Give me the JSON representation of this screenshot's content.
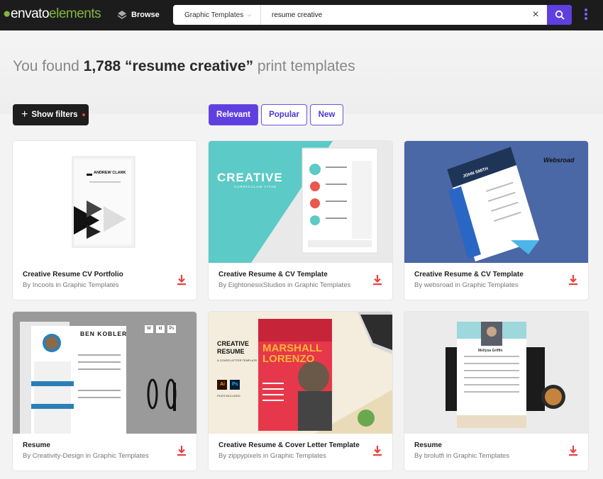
{
  "header": {
    "logo_text_a": "envato",
    "logo_text_b": "elements",
    "browse_label": "Browse",
    "category_select": "Graphic Templates",
    "search_value": "resume creative",
    "icons": [
      "browse-icon",
      "clear-icon",
      "search-icon",
      "more-icon"
    ],
    "accent": "#5f3fe0"
  },
  "results": {
    "prefix": "You found",
    "count_phrase": "1,788 “resume creative”",
    "suffix": "print templates"
  },
  "toolbar": {
    "show_filters": "Show filters",
    "sort": [
      {
        "label": "Relevant",
        "active": true
      },
      {
        "label": "Popular",
        "active": false
      },
      {
        "label": "New",
        "active": false
      }
    ]
  },
  "thumb_text": {
    "t1_name": "ANDREW CLARK",
    "t2_heading": "CREATIVE",
    "t2_sub": "CURRICULUM VITAE",
    "t3_brand": "Websroad",
    "t3_name": "JOHN SMITH",
    "t4_name": "BEN KOBLER",
    "t4_apps": [
      "W",
      "Id",
      "Ps"
    ],
    "t5_left_a": "CREATIVE",
    "t5_left_b": "RESUME",
    "t5_left_c": "& COVER LETTER TEMPLATE",
    "t5_files": "FILES INCLUDED",
    "t5_first": "MARSHALL",
    "t5_last": "LORENZO",
    "t6_name": "Mellysa Griffin"
  },
  "cards": [
    {
      "title": "Creative Resume CV Portfolio",
      "by": "By Incools in Graphic Templates"
    },
    {
      "title": "Creative Resume & CV Template",
      "by": "By EightonesixStudios in Graphic Templates"
    },
    {
      "title": "Creative Resume & CV Template",
      "by": "By websroad in Graphic Templates"
    },
    {
      "title": "Resume",
      "by": "By Creativity-Design in Graphic Templates"
    },
    {
      "title": "Creative Resume & Cover Letter Template",
      "by": "By zippypixels in Graphic Templates"
    },
    {
      "title": "Resume",
      "by": "By brolutfi in Graphic Templates"
    }
  ],
  "download_icon_color": "#e8413c"
}
